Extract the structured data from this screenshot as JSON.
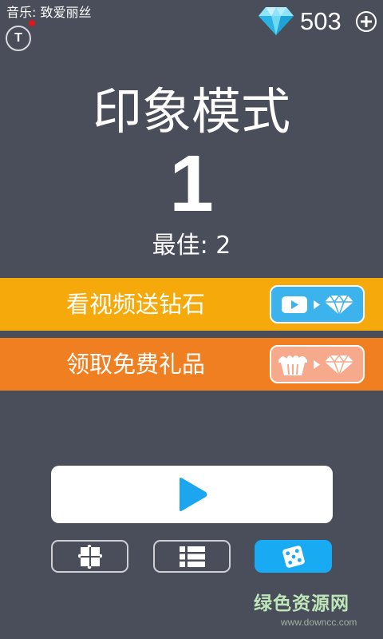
{
  "header": {
    "music_label": "音乐: 致爱丽丝",
    "t_button": "T",
    "gem_count": "503"
  },
  "game": {
    "mode_title": "印象模式",
    "level": "1",
    "best_score": "最佳: 2"
  },
  "banners": {
    "video_label": "看视频送钻石",
    "gift_label": "领取免费礼品"
  },
  "watermark": {
    "cn": "绿色资源网",
    "en": "www.downcc.com"
  },
  "colors": {
    "background": "#4a4d5a",
    "video_banner": "#f5a90b",
    "gift_banner": "#f07f22",
    "accent_blue": "#19aaf4",
    "play_icon": "#1ca6f0"
  },
  "icons": {
    "gem": "diamond-icon",
    "plus": "plus-circle-icon",
    "play": "play-icon",
    "video": "video-play-icon",
    "gift": "gift-box-icon",
    "puzzle": "puzzle-icon",
    "list": "list-icon",
    "dice": "dice-icon"
  }
}
